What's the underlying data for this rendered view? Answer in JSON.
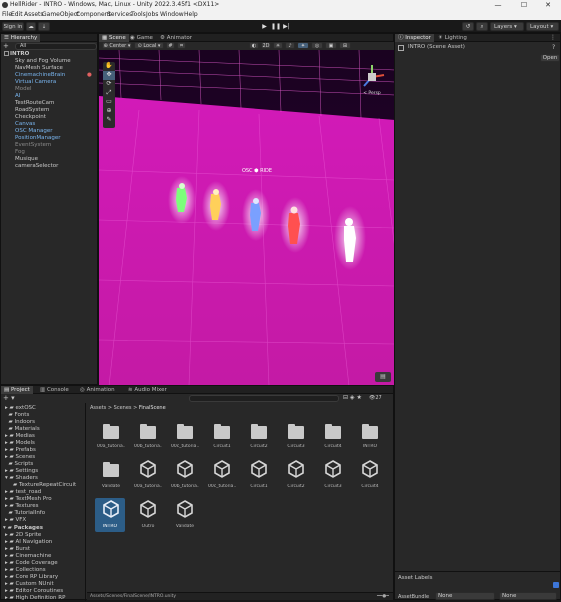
{
  "window": {
    "title": "HellRider - INTRO - Windows, Mac, Linux - Unity 2022.3.45f1 <DX11>",
    "minimize": "—",
    "maximize": "☐",
    "close": "✕"
  },
  "menu": [
    "File",
    "Edit",
    "Assets",
    "GameObject",
    "Component",
    "Services",
    "Tools",
    "Jobs",
    "Window",
    "Help"
  ],
  "toolbar": {
    "sign_in": "Sign in",
    "layers": "Layers",
    "layout": "Layout"
  },
  "hierarchy": {
    "tab": "Hierarchy",
    "search_placeholder": "All",
    "items": [
      {
        "label": "INTRO",
        "indent": 0,
        "style": "normal"
      },
      {
        "label": "Sky and Fog Volume",
        "indent": 2,
        "style": "normal"
      },
      {
        "label": "NavMesh Surface",
        "indent": 2,
        "style": "normal"
      },
      {
        "label": "CinemachineBrain",
        "indent": 2,
        "style": "blue"
      },
      {
        "label": "Virtual Camera",
        "indent": 2,
        "style": "blue"
      },
      {
        "label": "Model",
        "indent": 2,
        "style": "dim"
      },
      {
        "label": "AI",
        "indent": 2,
        "style": "blue"
      },
      {
        "label": "TestRouteCam",
        "indent": 2,
        "style": "normal"
      },
      {
        "label": "RoadSystem",
        "indent": 2,
        "style": "normal"
      },
      {
        "label": "Checkpoint",
        "indent": 2,
        "style": "normal"
      },
      {
        "label": "Canvas",
        "indent": 2,
        "style": "blue"
      },
      {
        "label": "OSC Manager",
        "indent": 2,
        "style": "blue"
      },
      {
        "label": "PositionManager",
        "indent": 2,
        "style": "blue"
      },
      {
        "label": "EventSystem",
        "indent": 2,
        "style": "dim"
      },
      {
        "label": "Fog",
        "indent": 2,
        "style": "dim"
      },
      {
        "label": "Musique",
        "indent": 2,
        "style": "normal"
      },
      {
        "label": "cameraSelector",
        "indent": 2,
        "style": "normal"
      }
    ]
  },
  "scene": {
    "tabs": [
      "Scene",
      "Game",
      "Animator"
    ],
    "pivot": "Center",
    "space": "Local",
    "persp": "< Persp"
  },
  "inspector": {
    "tabs": [
      "Inspector",
      "Lighting"
    ],
    "asset": "INTRO (Scene Asset)",
    "open": "Open",
    "asset_labels": "Asset Labels",
    "asset_bundle": "AssetBundle",
    "none1": "None",
    "none2": "None"
  },
  "project": {
    "tabs": [
      "Project",
      "Console",
      "Animation",
      "Audio Mixer"
    ],
    "breadcrumb": [
      "Assets",
      "Scenes",
      "FinalScene"
    ],
    "count": "27",
    "tree": [
      "extOSC",
      "Fonts",
      "Indoors",
      "Materials",
      "Medias",
      "Models",
      "Prefabs",
      "Scenes",
      "Scripts",
      "Settings",
      "Shaders",
      "TextureRepeatCircuit",
      "test_road",
      "TextMesh Pro",
      "Textures",
      "TutorialInfo",
      "VFX"
    ],
    "packages_label": "Packages",
    "packages": [
      "2D Sprite",
      "AI Navigation",
      "Burst",
      "Cinemachine",
      "Code Coverage",
      "Collections",
      "Core RP Library",
      "Custom NUnit",
      "Editor Coroutines",
      "High Definition RP"
    ],
    "row1": [
      "00a_tutoria...",
      "00b_tutoria...",
      "00c_tutoria...",
      "Circuit1",
      "Circuit2",
      "Circuit3",
      "Circuit4",
      "INTRO"
    ],
    "row2": [
      "Validate",
      "00a_tutoria...",
      "00b_tutoria...",
      "00c_tutoria...",
      "Circuit1",
      "Circuit2",
      "Circuit3",
      "Circuit4"
    ],
    "row3": [
      "INTRO",
      "Outro",
      "Validate"
    ],
    "status_path": "Assets/Scenes/FinalScene/INTRO.unity"
  },
  "game": {
    "logo": "OSC ⬢ RIDE"
  }
}
